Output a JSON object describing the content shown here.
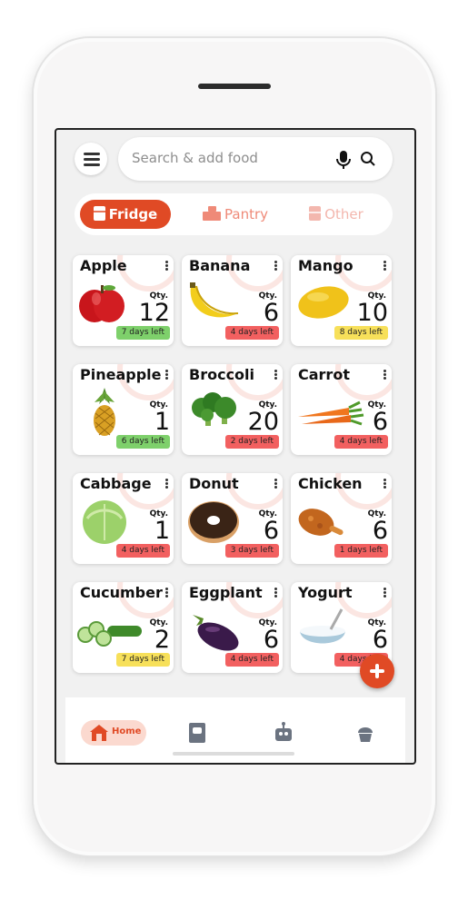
{
  "search": {
    "placeholder": "Search & add food"
  },
  "tabs": [
    {
      "label": "Fridge"
    },
    {
      "label": "Pantry"
    },
    {
      "label": "Other"
    }
  ],
  "qty_label": "Qty.",
  "items": [
    {
      "name": "Apple",
      "qty": "12",
      "days": "7 days left",
      "status": "green",
      "icon": "apple-icon"
    },
    {
      "name": "Banana",
      "qty": "6",
      "days": "4 days left",
      "status": "red",
      "icon": "banana-icon"
    },
    {
      "name": "Mango",
      "qty": "10",
      "days": "8 days left",
      "status": "yellow",
      "icon": "mango-icon"
    },
    {
      "name": "Pineapple",
      "qty": "1",
      "days": "6 days left",
      "status": "green",
      "icon": "pineapple-icon"
    },
    {
      "name": "Broccoli",
      "qty": "20",
      "days": "2 days left",
      "status": "red",
      "icon": "broccoli-icon"
    },
    {
      "name": "Carrot",
      "qty": "6",
      "days": "4 days left",
      "status": "red",
      "icon": "carrot-icon"
    },
    {
      "name": "Cabbage",
      "qty": "1",
      "days": "4 days left",
      "status": "red",
      "icon": "cabbage-icon"
    },
    {
      "name": "Donut",
      "qty": "6",
      "days": "3 days left",
      "status": "red",
      "icon": "donut-icon"
    },
    {
      "name": "Chicken",
      "qty": "6",
      "days": "1 days left",
      "status": "red",
      "icon": "chicken-icon"
    },
    {
      "name": "Cucumber",
      "qty": "2",
      "days": "7 days left",
      "status": "yellow",
      "icon": "cucumber-icon"
    },
    {
      "name": "Eggplant",
      "qty": "6",
      "days": "4 days left",
      "status": "red",
      "icon": "eggplant-icon"
    },
    {
      "name": "Yogurt",
      "qty": "6",
      "days": "4 days left",
      "status": "red",
      "icon": "yogurt-icon"
    }
  ],
  "nav": {
    "home_label": "Home"
  },
  "colors": {
    "accent": "#e04a25",
    "green": "#7ed06b",
    "red": "#f26060",
    "yellow": "#f7e05a"
  }
}
